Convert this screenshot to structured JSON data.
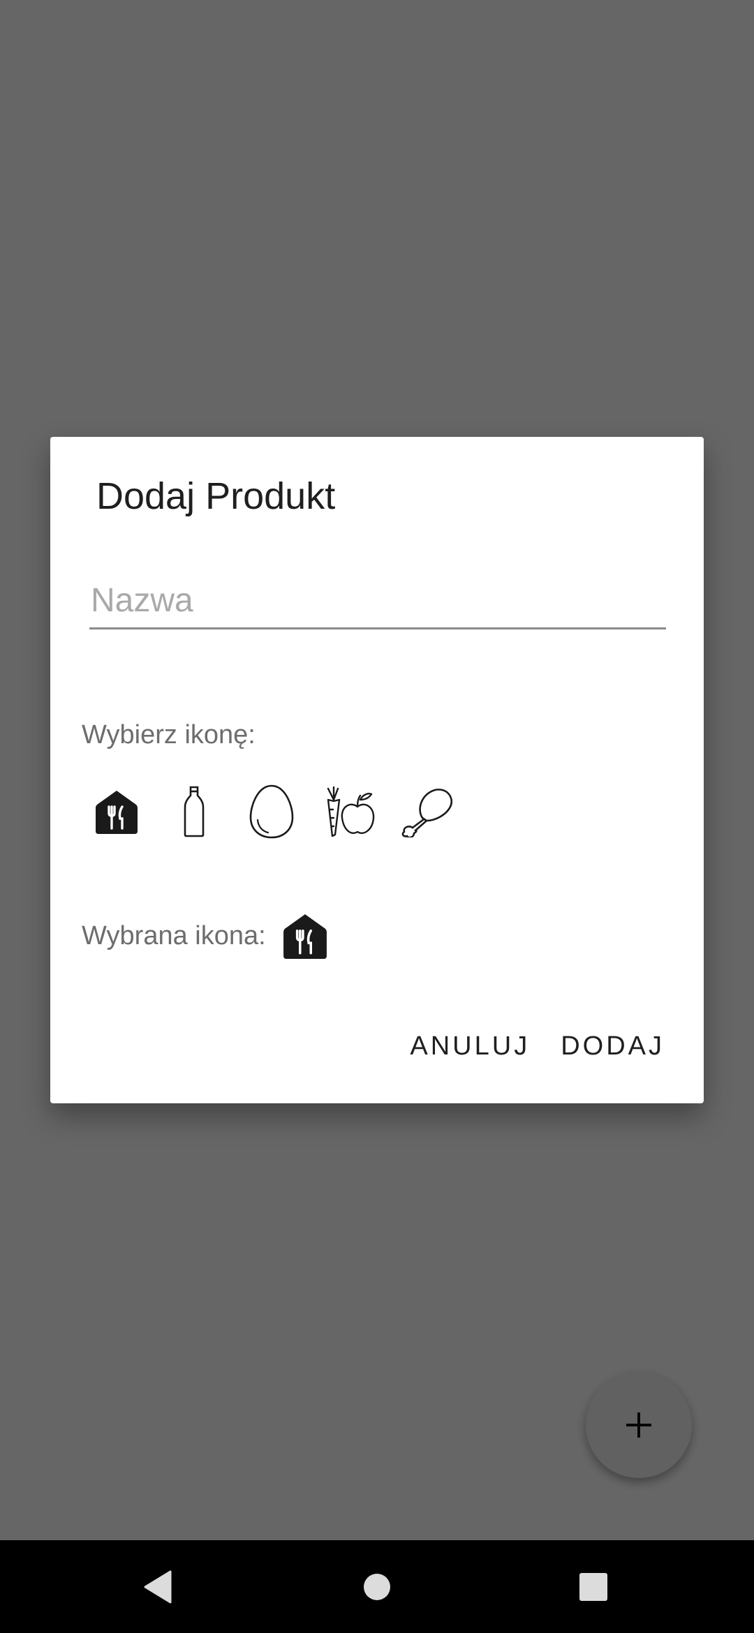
{
  "dialog": {
    "title": "Dodaj Produkt",
    "name_placeholder": "Nazwa",
    "name_value": "",
    "choose_icon_label": "Wybierz ikonę:",
    "icons": [
      "restaurant-icon",
      "bottle-icon",
      "egg-icon",
      "fruit-vegetable-icon",
      "chicken-leg-icon"
    ],
    "selected_icon_label": "Wybrana ikona:",
    "selected_icon": "restaurant-icon",
    "cancel_label": "ANULUJ",
    "add_label": "DODAJ"
  },
  "fab": {
    "icon": "plus-icon"
  },
  "navbar": {
    "buttons": [
      "back-icon",
      "home-icon",
      "recent-apps-icon"
    ]
  },
  "colors": {
    "scrim": "#000000",
    "dialog_bg": "#ffffff",
    "text_primary": "#1f1f1f",
    "text_secondary": "#6d6d6d",
    "navbar_bg": "#000000"
  }
}
